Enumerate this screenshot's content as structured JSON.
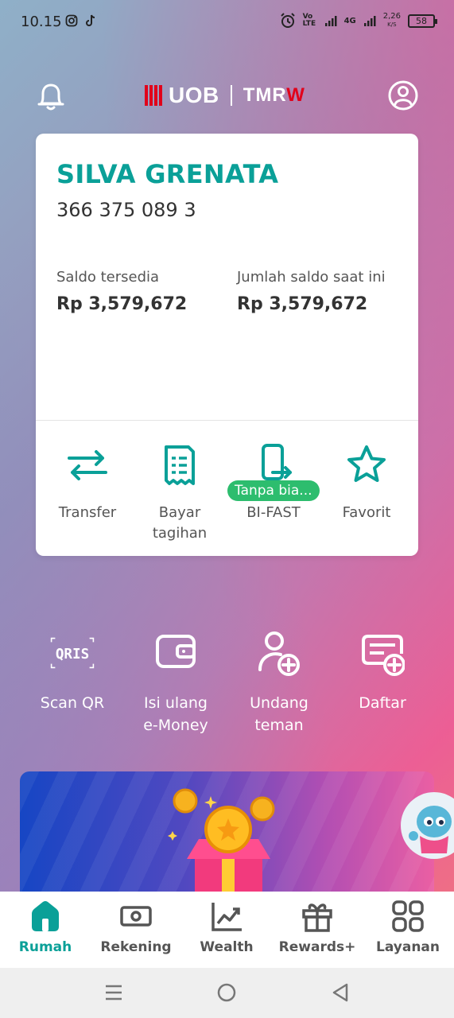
{
  "status_bar": {
    "time": "10.15",
    "network_label": "Vo LTE",
    "network_type": "4G",
    "speed_value": "2,26",
    "speed_unit": "K/S",
    "battery": "58"
  },
  "header": {
    "logo_uob": "UOB",
    "logo_tmrw_main": "TMR",
    "logo_tmrw_accent": "W"
  },
  "account": {
    "name": "SILVA GRENATA",
    "number": "366 375 089 3",
    "available_label": "Saldo tersedia",
    "available_value": "Rp 3,579,672",
    "current_label": "Jumlah saldo saat ini",
    "current_value": "Rp 3,579,672"
  },
  "card_actions": [
    {
      "label": "Transfer",
      "icon": "transfer-icon"
    },
    {
      "label": "Bayar tagihan",
      "icon": "bill-icon"
    },
    {
      "label": "BI-FAST",
      "icon": "phone-transfer-icon",
      "badge": "Tanpa bia..."
    },
    {
      "label": "Favorit",
      "icon": "star-icon"
    }
  ],
  "quick_actions": [
    {
      "label": "Scan QR",
      "icon": "qris-icon",
      "icon_text": "QRIS"
    },
    {
      "label": "Isi ulang e-Money",
      "icon": "wallet-icon"
    },
    {
      "label": "Undang teman",
      "icon": "add-user-icon"
    },
    {
      "label": "Daftar",
      "icon": "register-card-icon"
    }
  ],
  "bottom_nav": [
    {
      "label": "Rumah",
      "icon": "home-icon",
      "active": true
    },
    {
      "label": "Rekening",
      "icon": "money-icon",
      "active": false
    },
    {
      "label": "Wealth",
      "icon": "chart-icon",
      "active": false
    },
    {
      "label": "Rewards+",
      "icon": "gift-icon",
      "active": false
    },
    {
      "label": "Layanan",
      "icon": "grid-icon",
      "active": false
    }
  ],
  "colors": {
    "accent": "#0aa098",
    "badge": "#2dbd6e",
    "brand_red": "#e1001a"
  }
}
